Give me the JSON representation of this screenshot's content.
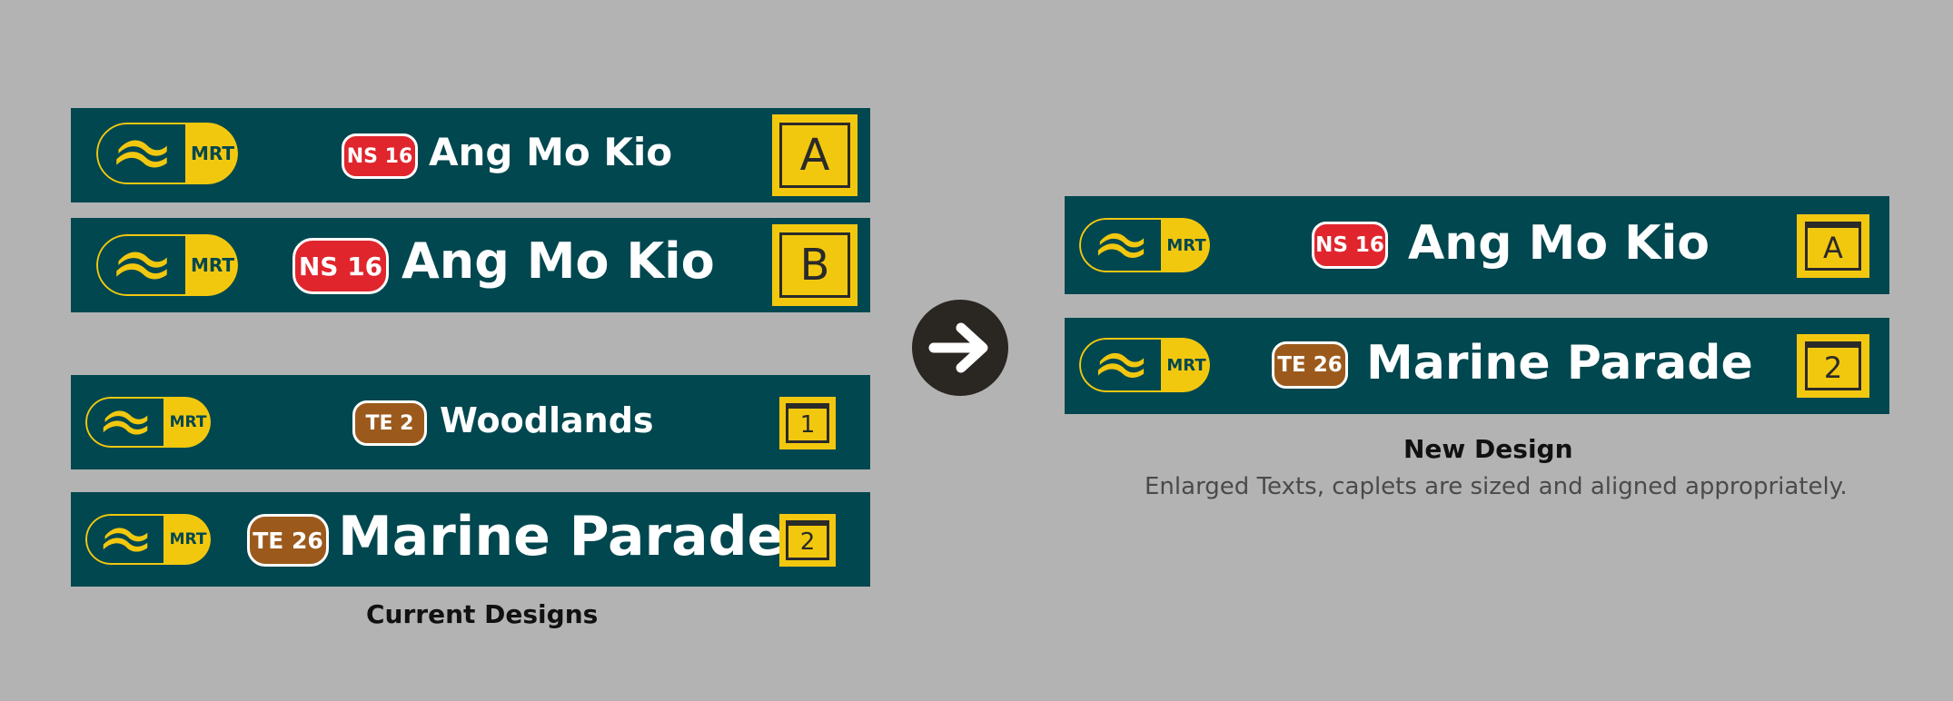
{
  "colors": {
    "background": "#b3b3b3",
    "sign_bg": "#00474f",
    "mrt_yellow": "#f2c80f",
    "ns_red": "#e0252d",
    "te_brown": "#9b5a1c"
  },
  "current": {
    "caption": "Current Designs",
    "signs": [
      {
        "logo_text": "MRT",
        "caplet": "NS 16",
        "station": "Ang Mo Kio",
        "exit": "A"
      },
      {
        "logo_text": "MRT",
        "caplet": "NS 16",
        "station": "Ang Mo Kio",
        "exit": "B"
      },
      {
        "logo_text": "MRT",
        "caplet": "TE 2",
        "station": "Woodlands",
        "exit": "1"
      },
      {
        "logo_text": "MRT",
        "caplet": "TE 26",
        "station": "Marine Parade",
        "exit": "2"
      }
    ]
  },
  "arrow_icon": "arrow-right-icon",
  "new": {
    "caption": "New Design",
    "subcaption": "Enlarged Texts, caplets are sized and aligned appropriately.",
    "signs": [
      {
        "logo_text": "MRT",
        "caplet": "NS 16",
        "station": "Ang Mo Kio",
        "exit": "A"
      },
      {
        "logo_text": "MRT",
        "caplet": "TE 26",
        "station": "Marine Parade",
        "exit": "2"
      }
    ]
  }
}
